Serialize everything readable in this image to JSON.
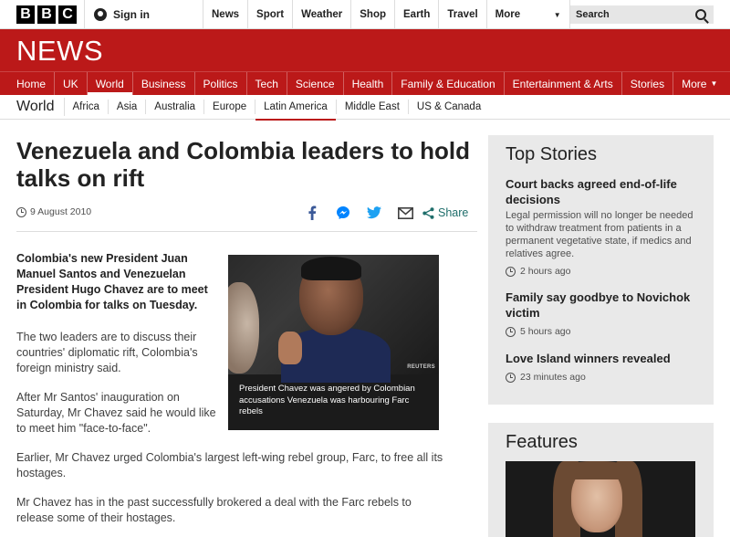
{
  "topbar": {
    "logo_letters": [
      "B",
      "B",
      "C"
    ],
    "signin_label": "Sign in",
    "nav": [
      "News",
      "Sport",
      "Weather",
      "Shop",
      "Earth",
      "Travel"
    ],
    "more_label": "More",
    "search_placeholder": "Search"
  },
  "banner": {
    "title": "NEWS"
  },
  "mainnav": {
    "items": [
      "Home",
      "UK",
      "World",
      "Business",
      "Politics",
      "Tech",
      "Science",
      "Health",
      "Family & Education",
      "Entertainment & Arts",
      "Stories"
    ],
    "more_label": "More",
    "active": "World"
  },
  "subnav": {
    "section": "World",
    "items": [
      "Africa",
      "Asia",
      "Australia",
      "Europe",
      "Latin America",
      "Middle East",
      "US & Canada"
    ],
    "active": "Latin America"
  },
  "article": {
    "headline": "Venezuela and Colombia leaders to hold talks on rift",
    "date": "9 August 2010",
    "share_label": "Share",
    "intro": "Colombia's new President Juan Manuel Santos and Venezuelan President Hugo Chavez are to meet in Colombia for talks on Tuesday.",
    "paragraphs": [
      "The two leaders are to discuss their countries' diplomatic rift, Colombia's foreign ministry said.",
      "After Mr Santos' inauguration on Saturday, Mr Chavez said he would like to meet him \"face-to-face\".",
      "Earlier, Mr Chavez urged Colombia's largest left-wing rebel group, Farc, to free all its hostages.",
      "Mr Chavez has in the past successfully brokered a deal with the Farc rebels to release some of their hostages."
    ],
    "photo_credit": "REUTERS",
    "photo_caption": "President Chavez was angered by Colombian accusations Venezuela was harbouring Farc rebels"
  },
  "sidebar": {
    "top_stories_heading": "Top Stories",
    "stories": [
      {
        "title": "Court backs agreed end-of-life decisions",
        "summary": "Legal permission will no longer be needed to withdraw treatment from patients in a permanent vegetative state, if medics and relatives agree.",
        "time": "2 hours ago"
      },
      {
        "title": "Family say goodbye to Novichok victim",
        "summary": "",
        "time": "5 hours ago"
      },
      {
        "title": "Love Island winners revealed",
        "summary": "",
        "time": "23 minutes ago"
      }
    ],
    "features_heading": "Features"
  },
  "colors": {
    "brand_red": "#bb1919",
    "share_teal": "#1f6e6b",
    "sidebar_bg": "#e9e9e9"
  }
}
